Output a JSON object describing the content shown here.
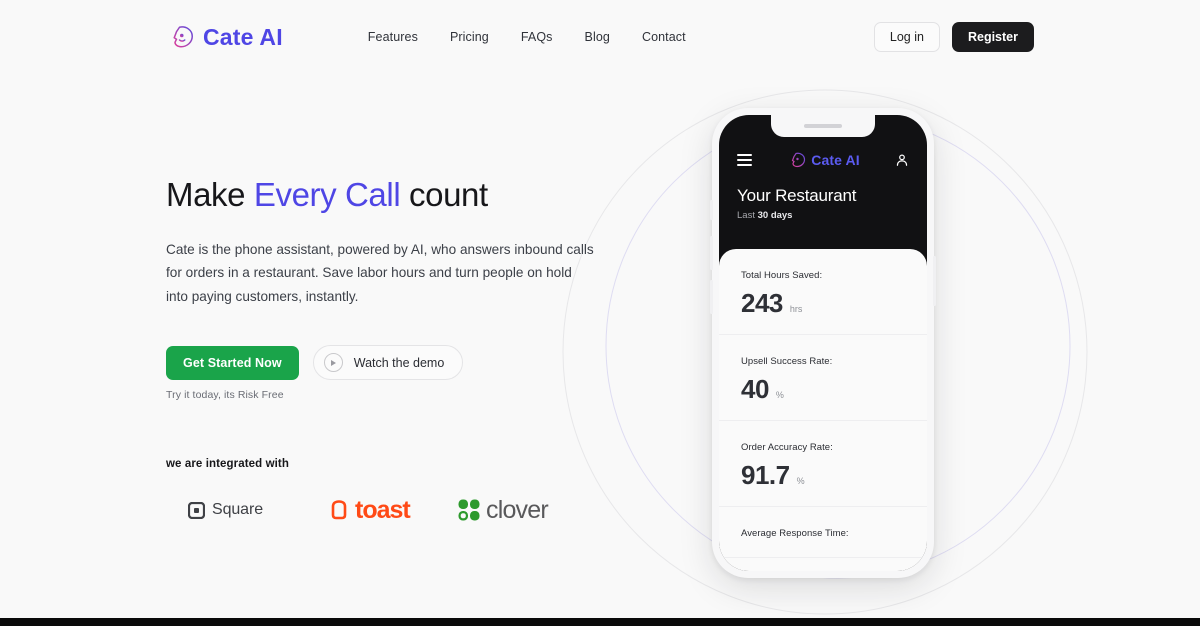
{
  "brand": {
    "name": "Cate AI",
    "icon": "cate-head-icon",
    "color": "#4f46e5"
  },
  "nav": {
    "links": [
      {
        "label": "Features"
      },
      {
        "label": "Pricing"
      },
      {
        "label": "FAQs"
      },
      {
        "label": "Blog"
      },
      {
        "label": "Contact"
      }
    ],
    "login_label": "Log in",
    "register_label": "Register"
  },
  "hero": {
    "headline_pre": "Make ",
    "headline_accent": "Every Call",
    "headline_post": " count",
    "subcopy": "Cate is the phone assistant, powered by AI, who answers inbound calls for orders in a restaurant. Save labor hours and turn people on hold into paying customers, instantly.",
    "primary_cta": "Get Started Now",
    "demo_cta": "Watch the demo",
    "demo_icon": "play-icon",
    "risk_note": "Try it today, its Risk Free",
    "primary_color": "#1aa44a"
  },
  "integrations": {
    "title": "we are integrated with",
    "partners": [
      {
        "name": "Square",
        "icon": "square-icon",
        "color": "#3f4146"
      },
      {
        "name": "toast",
        "icon": "toast-bread-icon",
        "color": "#ff4a16"
      },
      {
        "name": "clover",
        "icon": "clover-leaf-icon",
        "color": "#2d9a2d"
      }
    ]
  },
  "phone": {
    "app_bar": {
      "menu_icon": "hamburger-menu-icon",
      "brand_name": "Cate AI",
      "brand_icon": "cate-head-icon",
      "account_icon": "person-icon"
    },
    "restaurant_title": "Your Restaurant",
    "period_prefix": "Last ",
    "period_value": "30 days",
    "stats": [
      {
        "label": "Total Hours Saved:",
        "value": "243",
        "unit": "hrs"
      },
      {
        "label": "Upsell Success Rate:",
        "value": "40",
        "unit": "%"
      },
      {
        "label": "Order Accuracy Rate:",
        "value": "91.7",
        "unit": "%"
      },
      {
        "label": "Average Response Time:",
        "value": "",
        "unit": ""
      }
    ]
  }
}
